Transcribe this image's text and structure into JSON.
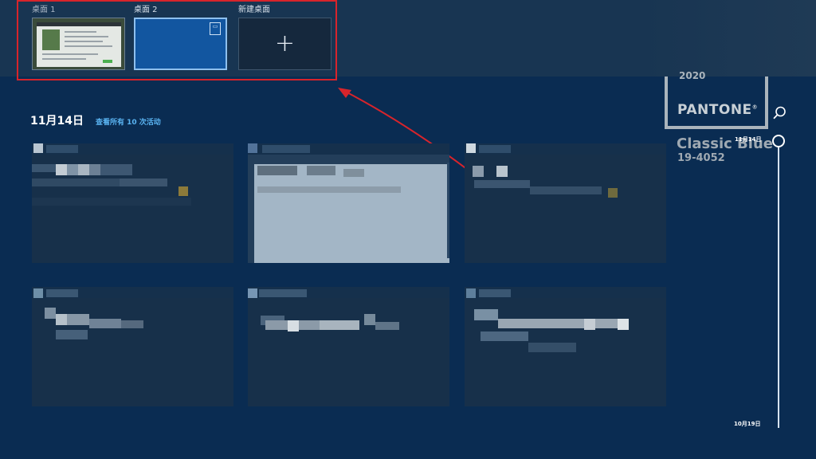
{
  "desktops": [
    {
      "label": "桌面 1"
    },
    {
      "label": "桌面 2"
    },
    {
      "label": "新建桌面"
    }
  ],
  "timeline": {
    "date_heading": "11月14日",
    "see_all": "查看所有 10 次活动",
    "scrubber_top": "11月14日",
    "scrubber_bottom": "10月19日"
  },
  "wallpaper": {
    "year": "2020",
    "brand": "PANTONE",
    "reg": "®",
    "color_name": "Classic Blue",
    "color_code": "19-4052"
  },
  "colors": {
    "background": "#0a2c52",
    "accent_link": "#5ab4f2",
    "annotation": "#d8242b",
    "active_desktop": "#1256a0"
  },
  "icons": {
    "new_desktop": "+",
    "search": "search-icon",
    "recycle_bin": "recycle-bin-icon"
  }
}
